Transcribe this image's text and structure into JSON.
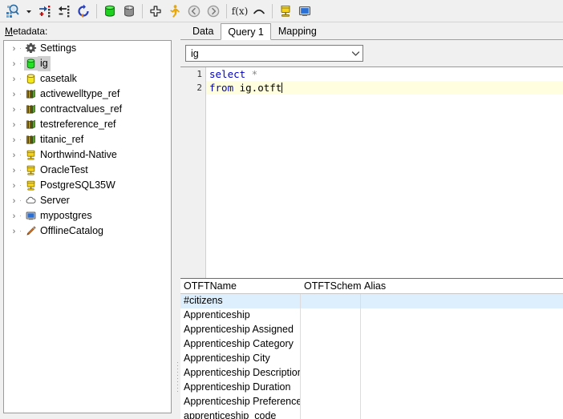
{
  "toolbar": {
    "buttons": [
      {
        "name": "new-query-icon",
        "label": "New Query"
      },
      {
        "name": "dropdown-arrow-icon",
        "label": "More"
      },
      {
        "name": "add-row-icon",
        "label": "Add Row"
      },
      {
        "name": "remove-row-icon",
        "label": "Remove Row"
      },
      {
        "name": "refresh-icon",
        "label": "Refresh"
      },
      {
        "name": "database-green-icon",
        "label": "Database"
      },
      {
        "name": "database-gray-icon",
        "label": "Database (inactive)"
      },
      {
        "name": "add-plus-icon",
        "label": "Add"
      },
      {
        "name": "run-icon",
        "label": "Run"
      },
      {
        "name": "back-icon",
        "label": "Back"
      },
      {
        "name": "forward-icon",
        "label": "Forward"
      },
      {
        "name": "function-icon",
        "label": "f(x)"
      },
      {
        "name": "arc-icon",
        "label": "Arc"
      },
      {
        "name": "server-icon",
        "label": "Server"
      },
      {
        "name": "monitor-icon",
        "label": "Monitor"
      }
    ]
  },
  "metadata": {
    "label_prefix": "M",
    "label_rest": "etadata:",
    "items": [
      {
        "label": "Settings",
        "icon": "gear-icon",
        "selected": false
      },
      {
        "label": "ig",
        "icon": "database-green-icon",
        "selected": true
      },
      {
        "label": "casetalk",
        "icon": "database-yellow-icon",
        "selected": false
      },
      {
        "label": "activewelltype_ref",
        "icon": "books-icon",
        "selected": false
      },
      {
        "label": "contractvalues_ref",
        "icon": "books-icon",
        "selected": false
      },
      {
        "label": "testreference_ref",
        "icon": "books-icon",
        "selected": false
      },
      {
        "label": "titanic_ref",
        "icon": "books-icon",
        "selected": false
      },
      {
        "label": "Northwind-Native",
        "icon": "server-icon",
        "selected": false
      },
      {
        "label": "OracleTest",
        "icon": "server-icon",
        "selected": false
      },
      {
        "label": "PostgreSQL35W",
        "icon": "server-icon",
        "selected": false
      },
      {
        "label": "Server",
        "icon": "cloud-icon",
        "selected": false
      },
      {
        "label": "mypostgres",
        "icon": "monitor-icon",
        "selected": false
      },
      {
        "label": "OfflineCatalog",
        "icon": "pencil-icon",
        "selected": false
      }
    ]
  },
  "tabs": [
    {
      "label": "Data",
      "active": false
    },
    {
      "label": "Query 1",
      "active": true
    },
    {
      "label": "Mapping",
      "active": false
    }
  ],
  "connection": {
    "value": "ig",
    "placeholder": "ig"
  },
  "editor": {
    "lines": [
      {
        "num": "1",
        "keyword": "select",
        "rest": " *",
        "current": false
      },
      {
        "num": "2",
        "keyword": "from",
        "rest": " ig.otft",
        "current": true
      }
    ]
  },
  "grid": {
    "columns": [
      "OTFTName",
      "OTFTSchema",
      "Alias"
    ],
    "rows": [
      {
        "name": "#citizens",
        "schema": "",
        "alias": "",
        "selected": true
      },
      {
        "name": "Apprenticeship",
        "schema": "",
        "alias": "",
        "selected": false
      },
      {
        "name": "Apprenticeship Assigned",
        "schema": "",
        "alias": "",
        "selected": false
      },
      {
        "name": "Apprenticeship Category",
        "schema": "",
        "alias": "",
        "selected": false
      },
      {
        "name": "Apprenticeship City",
        "schema": "",
        "alias": "",
        "selected": false
      },
      {
        "name": "Apprenticeship Description",
        "schema": "",
        "alias": "",
        "selected": false
      },
      {
        "name": "Apprenticeship Duration",
        "schema": "",
        "alias": "",
        "selected": false
      },
      {
        "name": "Apprenticeship Preference",
        "schema": "",
        "alias": "",
        "selected": false
      },
      {
        "name": "apprenticeship_code",
        "schema": "",
        "alias": "",
        "selected": false
      }
    ]
  },
  "colors": {
    "selection": "#cfcfcf",
    "row_selection": "#ddeefc",
    "current_line": "#ffffe0",
    "keyword": "#0000c8",
    "chrome": "#f0f0f0"
  }
}
